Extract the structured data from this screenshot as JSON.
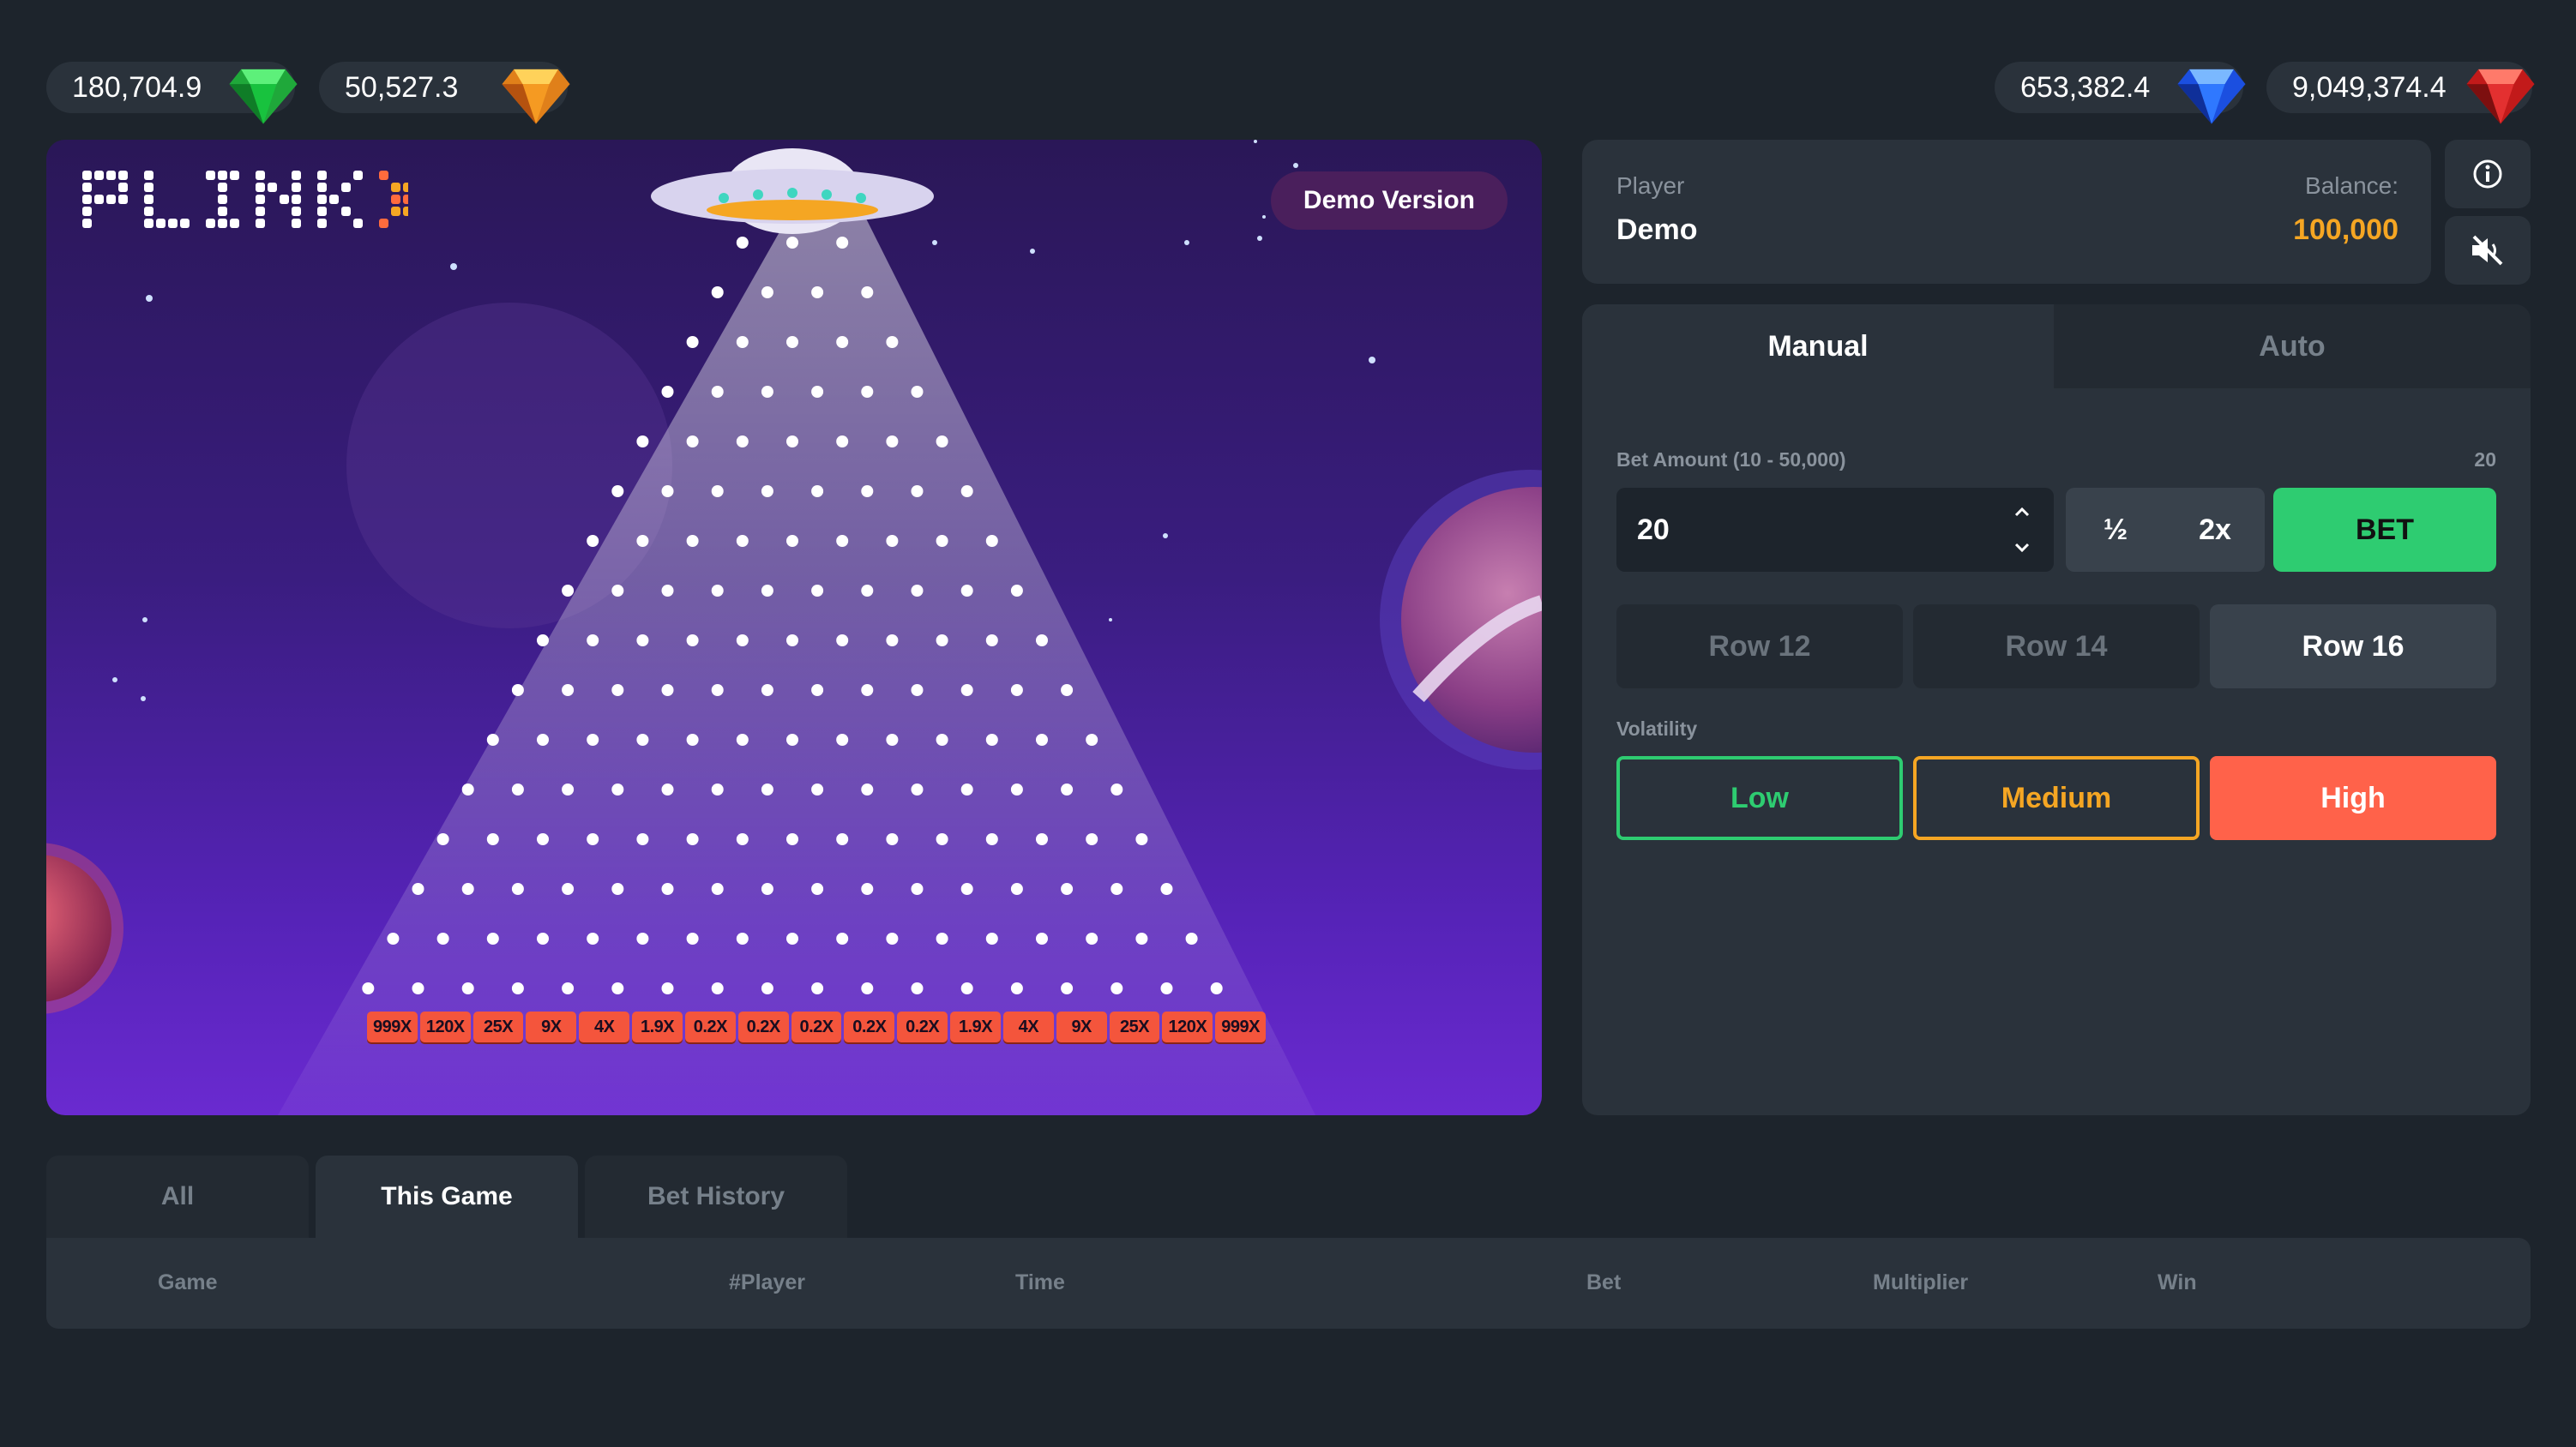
{
  "jackpots": [
    {
      "value": "180,704.9",
      "gem": "green-gem-icon",
      "color": "#2ecc40"
    },
    {
      "value": "50,527.3",
      "gem": "orange-gem-icon",
      "color": "#f5a623"
    },
    {
      "value": "653,382.4",
      "gem": "blue-gem-icon",
      "color": "#2a6bff"
    },
    {
      "value": "9,049,374.4",
      "gem": "red-gem-icon",
      "color": "#e02525"
    }
  ],
  "game": {
    "logo": "PLINKX",
    "demo_badge": "Demo Version",
    "peg_rows": 16,
    "multipliers": [
      "999X",
      "120X",
      "25X",
      "9X",
      "4X",
      "1.9X",
      "0.2X",
      "0.2X",
      "0.2X",
      "0.2X",
      "0.2X",
      "1.9X",
      "4X",
      "9X",
      "25X",
      "120X",
      "999X"
    ]
  },
  "player": {
    "label": "Player",
    "name": "Demo",
    "balance_label": "Balance:",
    "balance": "100,000"
  },
  "controls": {
    "tabs": [
      {
        "label": "Manual",
        "active": true
      },
      {
        "label": "Auto",
        "active": false
      }
    ],
    "bet_label": "Bet Amount (10 - 50,000)",
    "bet_right": "20",
    "bet_value": "20",
    "half_label": "½",
    "double_label": "2x",
    "bet_button": "BET",
    "rows": [
      {
        "label": "Row 12",
        "active": false
      },
      {
        "label": "Row 14",
        "active": false
      },
      {
        "label": "Row 16",
        "active": true
      }
    ],
    "volatility_label": "Volatility",
    "volatility": [
      {
        "label": "Low"
      },
      {
        "label": "Medium"
      },
      {
        "label": "High",
        "active": true
      }
    ],
    "accent_green": "#2ecc71",
    "accent_orange": "#f5a623",
    "accent_red": "#ff624a"
  },
  "history": {
    "tabs": [
      {
        "label": "All"
      },
      {
        "label": "This Game",
        "active": true
      },
      {
        "label": "Bet History"
      }
    ],
    "columns": [
      "Game",
      "#Player",
      "Time",
      "Bet",
      "Multiplier",
      "Win"
    ]
  }
}
